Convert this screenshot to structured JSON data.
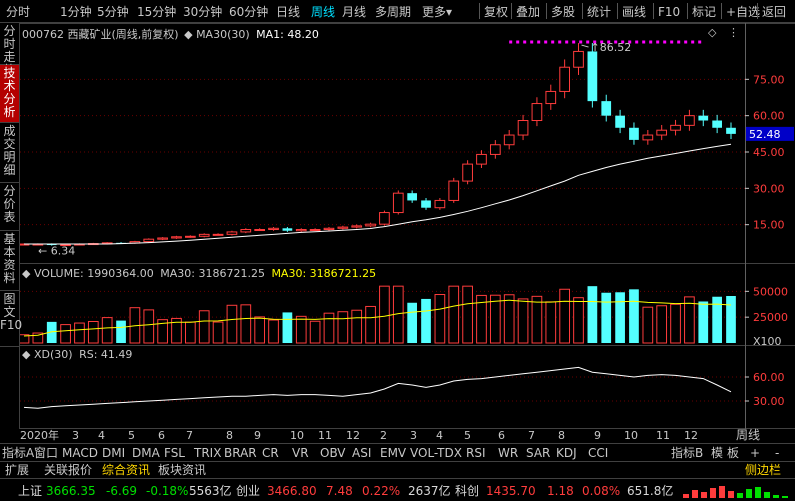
{
  "toolbar": {
    "left_items": [
      "分时",
      "1分钟",
      "5分钟",
      "15分钟",
      "30分钟",
      "60分钟",
      "日线",
      "周线",
      "月线",
      "多周期",
      "更多"
    ],
    "active_index": 7,
    "right_items": [
      "复权",
      "叠加",
      "多股",
      "统计",
      "画线",
      "F10",
      "标记",
      "+自选",
      "返回"
    ]
  },
  "left_tabs": [
    {
      "label": "分时走势",
      "active": false
    },
    {
      "label": "技术分析",
      "active": true
    },
    {
      "label": "成交明细",
      "active": false
    },
    {
      "label": "分价表",
      "active": false
    },
    {
      "label": "基本资料",
      "active": false
    },
    {
      "label": "图文F10",
      "active": false
    }
  ],
  "main_panel": {
    "stock_code": "000762",
    "stock_name": "西藏矿业",
    "period_info": "(周线,前复权)",
    "ma_label": "MA30(30)",
    "ma1_label": "MA1:",
    "ma1_value": "48.20",
    "current_price": "52.48",
    "high_label": "86.52",
    "low_label": "6.34",
    "y_ticks": [
      "75.00",
      "60.00",
      "45.00",
      "30.00",
      "15.00"
    ]
  },
  "volume_panel": {
    "label": "VOLUME:",
    "value": "1990364.00",
    "ma30_label": "MA30:",
    "ma30_value": "3186721.25",
    "ma30_label_2": "MA30:",
    "ma30_value_2": "3186721.25",
    "y_ticks": [
      "50000",
      "25000"
    ],
    "unit": "X100"
  },
  "rs_panel": {
    "label": "XD(30)",
    "rs_label": "RS:",
    "rs_value": "41.49",
    "y_ticks": [
      "60.00",
      "30.00"
    ]
  },
  "month_axis": {
    "year_label": "2020年",
    "months": [
      "3",
      "4",
      "5",
      "6",
      "7",
      "8",
      "9",
      "10",
      "11",
      "12",
      "2",
      "3",
      "4",
      "5",
      "6",
      "7",
      "8",
      "9",
      "10",
      "11",
      "12"
    ],
    "right_label": "周线"
  },
  "indicator_tabs": {
    "items": [
      "指标A",
      "窗口",
      "MACD",
      "DMI",
      "DMA",
      "FSL",
      "TRIX",
      "BRAR",
      "CR",
      "VR",
      "OBV",
      "ASI",
      "EMV",
      "VOL-TDX",
      "RSI",
      "WR",
      "SAR",
      "KDJ",
      "CCI"
    ],
    "right_items": [
      "指标B",
      "模",
      "板",
      "+",
      "-"
    ]
  },
  "panel_tabs": {
    "items": [
      "扩展",
      "关联报价",
      "综合资讯",
      "板块资讯"
    ],
    "active_index": 2,
    "right_label": "侧边栏"
  },
  "status_bar": {
    "sh_name": "上证",
    "sh_value": "3666.35",
    "sh_change": "-6.69",
    "sh_pct": "-0.18%",
    "sh_amount": "5563亿",
    "cy_name": "创业",
    "cy_value": "3466.80",
    "cy_change": "7.48",
    "cy_pct": "0.22%",
    "cy_amount": "2637亿",
    "kc_name": "科创",
    "kc_value": "1435.70",
    "kc_change": "1.18",
    "kc_pct": "0.08%",
    "kc_amount": "651.8亿"
  },
  "colors": {
    "up": "#ff3c3c",
    "down": "#54ffff",
    "ma": "#ffffff",
    "vol_ma": "#ffff00",
    "highlight": "#ff00ff",
    "price_box": "#0000c8"
  },
  "chart_data": {
    "type": "candlestick",
    "weeks": 52,
    "price_series": {
      "name": "西藏矿业",
      "close_estimates": [
        7,
        7,
        6.6,
        6.8,
        7,
        7.2,
        7.5,
        7.4,
        8,
        9,
        9.5,
        10,
        10.2,
        11,
        11,
        12,
        13,
        13,
        13.5,
        12.5,
        13,
        13,
        13.5,
        14,
        14.5,
        15.2,
        20,
        28,
        25,
        22,
        25,
        33,
        40,
        44,
        48,
        52,
        58,
        65,
        70,
        80,
        86.52,
        66,
        60,
        55,
        50,
        52,
        54,
        56,
        60,
        58,
        55,
        52.48
      ],
      "y_range": [
        0,
        90
      ]
    },
    "ma30_estimates": [
      7,
      7,
      7,
      7,
      7,
      7,
      7,
      7.2,
      7.4,
      7.6,
      7.9,
      8.2,
      8.6,
      9,
      9.4,
      9.8,
      10.2,
      10.6,
      11,
      11.4,
      11.8,
      12.1,
      12.4,
      12.7,
      13,
      13.4,
      14.2,
      15.2,
      16.2,
      17,
      18,
      19.2,
      20.5,
      22,
      23.6,
      25.2,
      27,
      29,
      31,
      33,
      35.4,
      37,
      38.6,
      40,
      41.2,
      42.4,
      43.4,
      44.4,
      45.4,
      46.4,
      47.3,
      48.2
    ],
    "volume_y_range": [
      0,
      60000
    ],
    "rs_series": {
      "name": "RS",
      "y_range": [
        0,
        80
      ],
      "values_estimate": [
        22,
        21,
        23,
        24,
        25,
        26,
        27,
        28,
        29,
        30,
        31,
        32,
        33,
        34,
        35,
        36,
        36,
        37,
        38,
        37,
        38,
        38,
        37,
        36,
        38,
        40,
        45,
        52,
        50,
        47,
        50,
        55,
        57,
        58,
        60,
        62,
        64,
        66,
        68,
        70,
        72,
        66,
        64,
        62,
        60,
        62,
        63,
        62,
        60,
        58,
        50,
        41.49
      ]
    }
  }
}
